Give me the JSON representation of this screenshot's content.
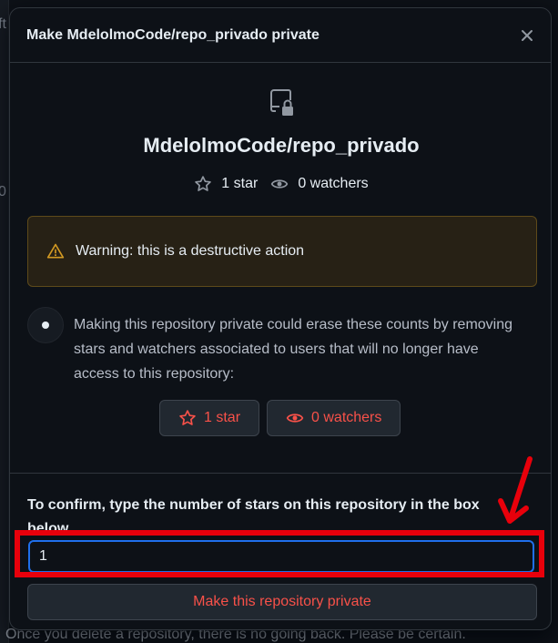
{
  "background": {
    "peek_top": "ft",
    "peek_mid": "0",
    "bottom_text": "Once you delete a repository, there is no going back. Please be certain."
  },
  "dialog": {
    "title": "Make MdelolmoCode/repo_privado private",
    "close_icon": "close-icon",
    "repo_icon": "repo-locked-icon",
    "repo_name": "MdelolmoCode/repo_privado",
    "stars_label": "1 star",
    "watchers_label": "0 watchers",
    "warning_text": "Warning: this is a destructive action",
    "explanation": "Making this repository private could erase these counts by removing stars and watchers associated to users that will no longer have access to this repository:",
    "stars_pill": "1 star",
    "watchers_pill": "0 watchers",
    "confirm_label": "To confirm, type the number of stars on this repository in the box below",
    "confirm_value": "1",
    "confirm_button": "Make this repository private"
  },
  "colors": {
    "danger": "#f85149",
    "warning": "#d29922",
    "focus": "#1f6feb",
    "annotation": "#e8000b"
  }
}
